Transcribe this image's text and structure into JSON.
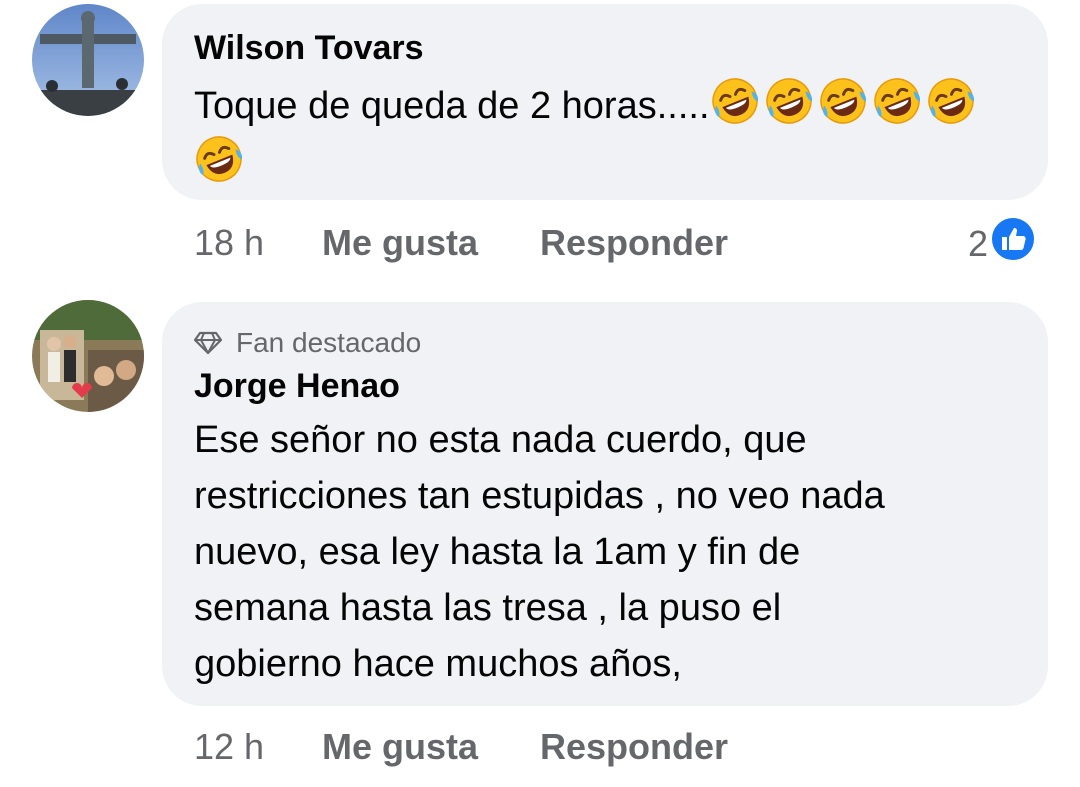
{
  "comments": [
    {
      "author": "Wilson Tovars",
      "text": "Toque de queda de 2 horas.....",
      "emoji_icon": "rolling-on-floor-laughing-icon",
      "emoji_count": 6,
      "time": "18 h",
      "like_label": "Me gusta",
      "reply_label": "Responder",
      "reaction_count": "2",
      "reaction_icon": "like-icon"
    },
    {
      "badge": "Fan destacado",
      "author": "Jorge Henao",
      "text_lines": [
        "Ese señor no esta nada cuerdo, que",
        "restricciones tan estupidas ,  no veo nada",
        "nuevo, esa ley  hasta la 1am y fin de",
        "semana hasta las tresa , la puso el",
        "gobierno hace muchos años,"
      ],
      "time": "12 h",
      "like_label": "Me gusta",
      "reply_label": "Responder"
    }
  ],
  "colors": {
    "bubble": "#f0f2f5",
    "secondary_text": "#65676b",
    "like_blue": "#1877f2"
  }
}
